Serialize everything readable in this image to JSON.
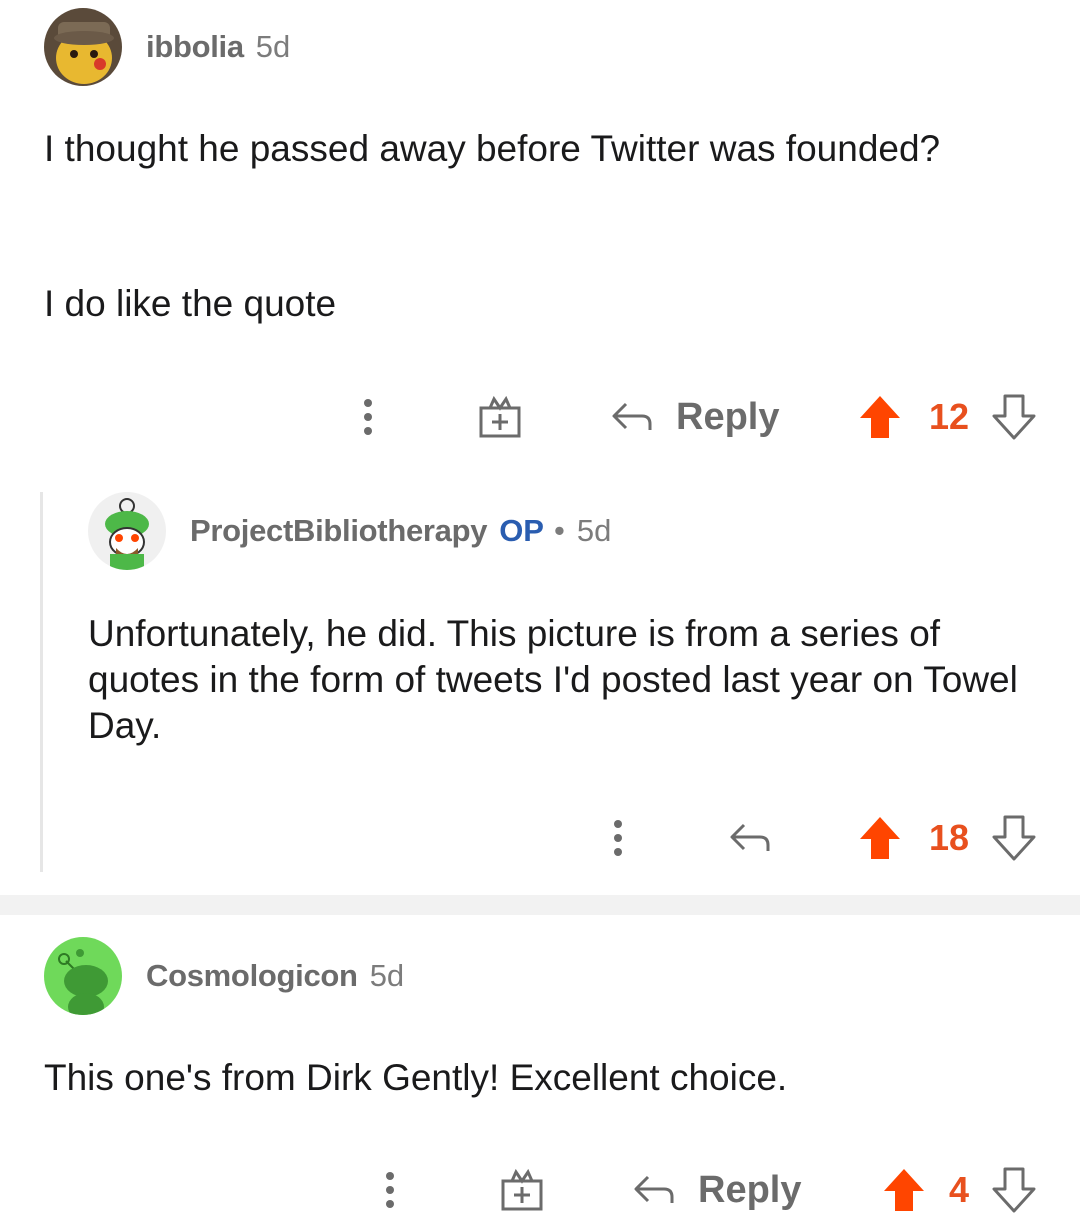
{
  "comments": [
    {
      "username": "ibbolia",
      "age": "5d",
      "paragraphs": [
        "I thought he passed away before Twitter was founded?",
        "I do like the quote"
      ],
      "reply_label": "Reply",
      "score": "12"
    },
    {
      "username": "ProjectBibliotherapy",
      "op_badge": "OP",
      "dot": "•",
      "age": "5d",
      "paragraphs": [
        "Unfortunately, he did. This picture is from a series of quotes in the form of tweets I'd posted last year on Towel Day."
      ],
      "score": "18"
    },
    {
      "username": "Cosmologicon",
      "age": "5d",
      "paragraphs": [
        "This one's from Dirk Gently! Excellent choice."
      ],
      "reply_label": "Reply",
      "score": "4"
    }
  ],
  "colors": {
    "upvote_active": "#ff4500",
    "score": "#e8501e",
    "op_badge": "#2a5db0",
    "muted": "#6b6b6b"
  },
  "icons": [
    "more-options-icon",
    "award-icon",
    "reply-arrow-icon",
    "upvote-icon",
    "downvote-icon"
  ]
}
